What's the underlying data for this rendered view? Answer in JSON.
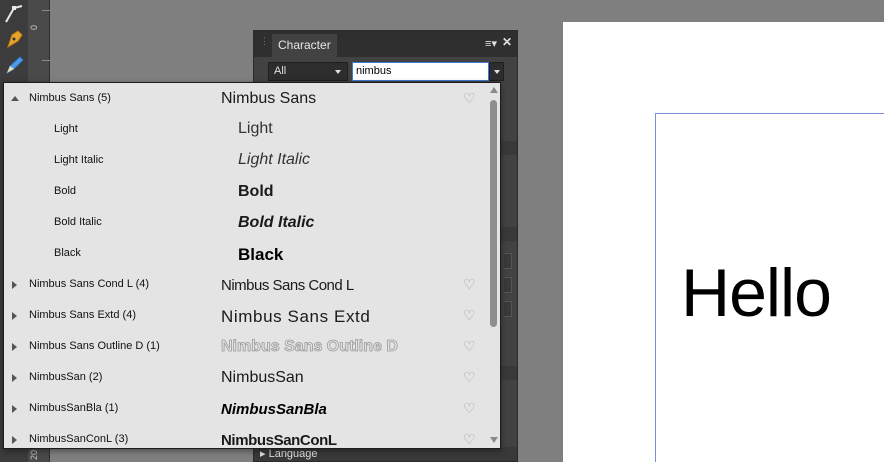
{
  "panel": {
    "tab_label": "Character",
    "collection": "All",
    "search_value": "nimbus",
    "language_label": "Language"
  },
  "ruler": {
    "labels": [
      "0",
      "20"
    ]
  },
  "document": {
    "text": "Hello"
  },
  "font_list": [
    {
      "name": "Nimbus Sans (5)",
      "preview": "Nimbus Sans",
      "level": "family",
      "expanded": true
    },
    {
      "name": "Light",
      "preview": "Light",
      "level": "style"
    },
    {
      "name": "Light Italic",
      "preview": "Light Italic",
      "level": "style"
    },
    {
      "name": "Bold",
      "preview": "Bold",
      "level": "style"
    },
    {
      "name": "Bold Italic",
      "preview": "Bold Italic",
      "level": "style"
    },
    {
      "name": "Black",
      "preview": "Black",
      "level": "style"
    },
    {
      "name": "Nimbus Sans Cond L (4)",
      "preview": "Nimbus Sans Cond L",
      "level": "family",
      "expanded": false
    },
    {
      "name": "Nimbus Sans Extd (4)",
      "preview": "Nimbus Sans Extd",
      "level": "family",
      "expanded": false
    },
    {
      "name": "Nimbus Sans Outline D (1)",
      "preview": "Nimbus Sans Outline D",
      "level": "family",
      "expanded": false
    },
    {
      "name": "NimbusSan (2)",
      "preview": "NimbusSan",
      "level": "family",
      "expanded": false
    },
    {
      "name": "NimbusSanBla (1)",
      "preview": "NimbusSanBla",
      "level": "family",
      "expanded": false
    },
    {
      "name": "NimbusSanConL (3)",
      "preview": "NimbusSanConL",
      "level": "family",
      "expanded": false
    }
  ],
  "colors": {
    "panel_bg": "#424242",
    "dropdown_bg": "#e4e4e4",
    "search_border": "#3e7ad6",
    "guide": "#7b8fd6"
  }
}
